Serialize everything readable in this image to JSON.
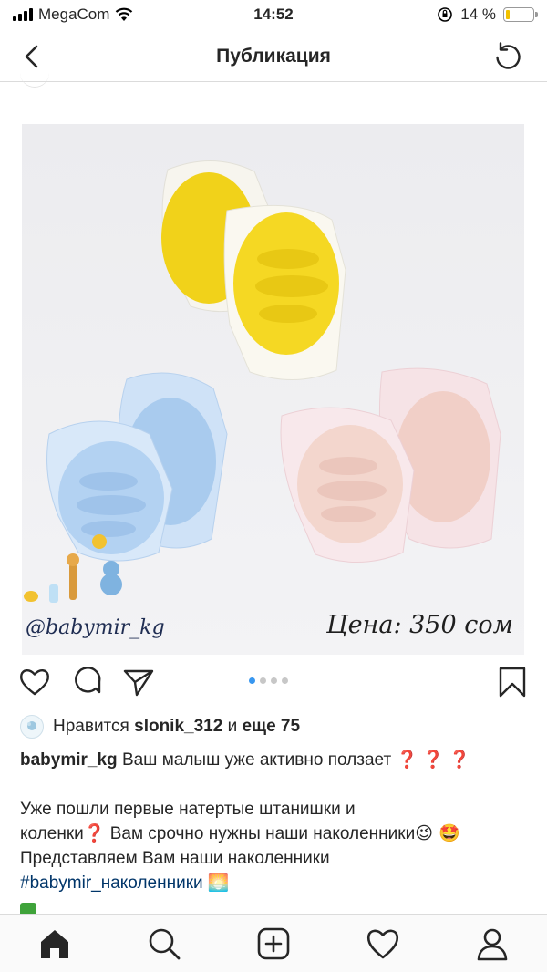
{
  "status_bar": {
    "carrier": "MegaCom",
    "time": "14:52",
    "battery_percent": "14 %",
    "battery_level": 0.14
  },
  "nav": {
    "title": "Публикация",
    "back_icon": "chevron-left-icon",
    "refresh_icon": "refresh-icon"
  },
  "post": {
    "image_brand_text": "@babymir_kg",
    "image_price_text": "Цена: 350 сом",
    "carousel": {
      "count": 4,
      "active": 1
    },
    "likes": {
      "prefix": "Нравится",
      "user": "slonik_312",
      "middle": "и",
      "rest": "еще 75"
    },
    "caption": {
      "username": "babymir_kg",
      "line1_text": "Ваш малыш уже активно ползает",
      "line1_marks": "❓ ❓ ❓",
      "p2_line1": "Уже пошли первые натертые штанишки и",
      "p2_line2_a": "коленки",
      "p2_line2_mark": "❓",
      "p2_line2_b": "Вам срочно нужны наши наколенники",
      "p2_line2_emoji": "😉 🤩",
      "p2_line3": "Представляем Вам наши наколенники",
      "hashtag": "#babymir_наколенники",
      "hashtag_emoji": "🌅"
    }
  },
  "tabs": [
    "home-icon",
    "search-icon",
    "add-post-icon",
    "activity-heart-icon",
    "profile-icon"
  ]
}
